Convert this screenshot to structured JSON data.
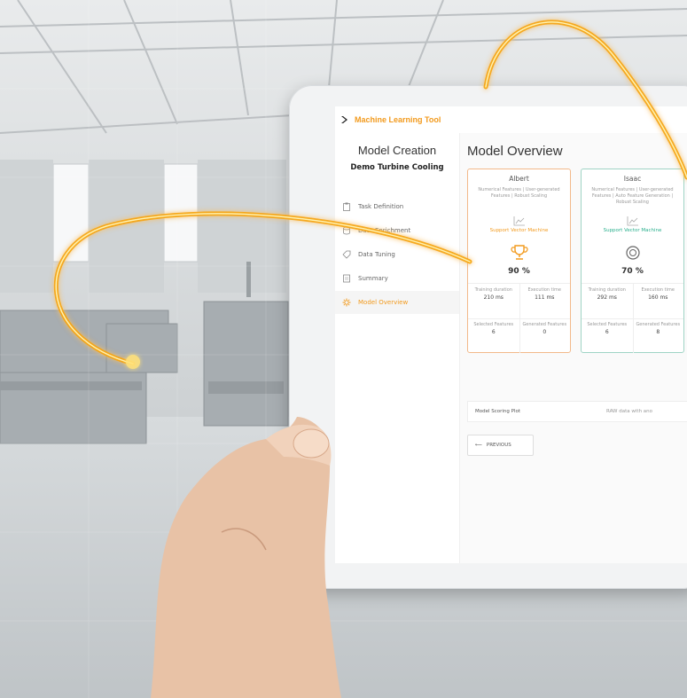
{
  "app": {
    "title": "Machine Learning Tool"
  },
  "sidebar": {
    "heading": "Model Creation",
    "project": "Demo Turbine Cooling",
    "items": [
      {
        "label": "Task Definition",
        "icon": "clipboard-icon",
        "active": false
      },
      {
        "label": "Data Enrichment",
        "icon": "database-icon",
        "active": false
      },
      {
        "label": "Data Tuning",
        "icon": "tag-icon",
        "active": false
      },
      {
        "label": "Summary",
        "icon": "document-icon",
        "active": false
      },
      {
        "label": "Model Overview",
        "icon": "gear-icon",
        "active": true
      }
    ]
  },
  "main": {
    "title": "Model Overview",
    "cards": [
      {
        "name": "Albert",
        "description": "Numerical Features | User-generated Features | Robust Scaling",
        "algorithm": "Support Vector Machine",
        "score": "90 %",
        "big_icon": "trophy-icon",
        "metrics": [
          {
            "label": "Training duration",
            "value": "210 ms"
          },
          {
            "label": "Execution time",
            "value": "111 ms"
          },
          {
            "label": "Selected Features",
            "value": "6"
          },
          {
            "label": "Generated Features",
            "value": "0"
          }
        ],
        "accent": "#f29a1d"
      },
      {
        "name": "Isaac",
        "description": "Numerical Features | User-generated Features | Auto Feature Generation | Robust Scaling",
        "algorithm": "Support Vector Machine",
        "score": "70 %",
        "big_icon": "medal-icon",
        "metrics": [
          {
            "label": "Training duration",
            "value": "292 ms"
          },
          {
            "label": "Execution time",
            "value": "160 ms"
          },
          {
            "label": "Selected Features",
            "value": "6"
          },
          {
            "label": "Generated Features",
            "value": "8"
          }
        ],
        "accent": "#2bb08e"
      }
    ],
    "scoring_plot": {
      "label": "Model Scoring Plot",
      "note": "RAW data with ano"
    },
    "previous_button": "PREVIOUS"
  }
}
